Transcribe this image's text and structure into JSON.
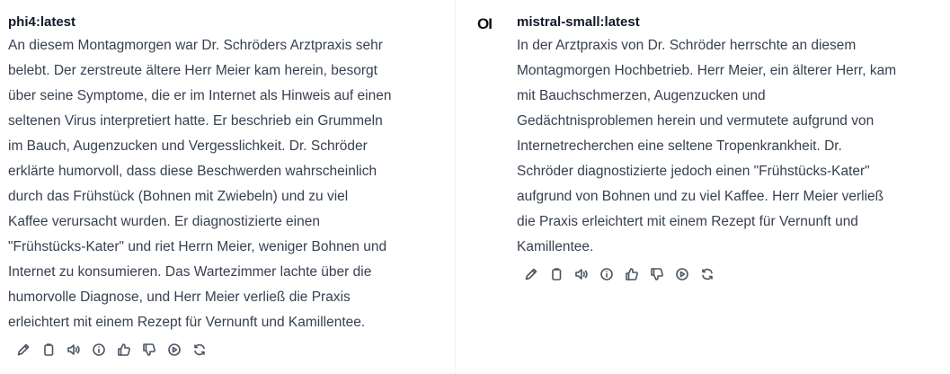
{
  "left": {
    "model_name": "phi4:latest",
    "message_lines": [
      "An diesem Montagmorgen war Dr. Schröders Arztpraxis sehr",
      "belebt. Der zerstreute ältere Herr Meier kam herein, besorgt",
      "über seine Symptome, die er im Internet als Hinweis auf einen",
      "seltenen Virus interpretiert hatte. Er beschrieb ein Grummeln",
      "im Bauch, Augenzucken und Vergesslichkeit. Dr. Schröder",
      "erklärte humorvoll, dass diese Beschwerden wahrscheinlich",
      "durch das Frühstück (Bohnen mit Zwiebeln) und zu viel",
      "Kaffee verursacht wurden. Er diagnostizierte einen",
      "\"Frühstücks-Kater\" und riet Herrn Meier, weniger Bohnen und",
      "Internet zu konsumieren. Das Wartezimmer lachte über die",
      "humorvolle Diagnose, und Herr Meier verließ die Praxis",
      "erleichtert mit einem Rezept für Vernunft und Kamillentee."
    ]
  },
  "right": {
    "logo_text": "OI",
    "model_name": "mistral-small:latest",
    "message_lines": [
      "In der Arztpraxis von Dr. Schröder herrschte an diesem",
      "Montagmorgen Hochbetrieb. Herr Meier, ein älterer Herr, kam",
      "mit Bauchschmerzen, Augenzucken und",
      "Gedächtnisproblemen herein und vermutete aufgrund von",
      "Internetrecherchen eine seltene Tropenkrankheit. Dr.",
      "Schröder diagnostizierte jedoch einen \"Frühstücks-Kater\"",
      "aufgrund von Bohnen und zu viel Kaffee. Herr Meier verließ",
      "die Praxis erleichtert mit einem Rezept für Vernunft und",
      "Kamillentee."
    ]
  },
  "action_icons": [
    "edit-icon",
    "copy-icon",
    "read-aloud-icon",
    "info-icon",
    "thumbs-up-icon",
    "thumbs-down-icon",
    "continue-icon",
    "regenerate-icon"
  ],
  "colors": {
    "text": "#374151",
    "heading": "#111827",
    "icon": "#4b5563",
    "background": "#ffffff"
  }
}
